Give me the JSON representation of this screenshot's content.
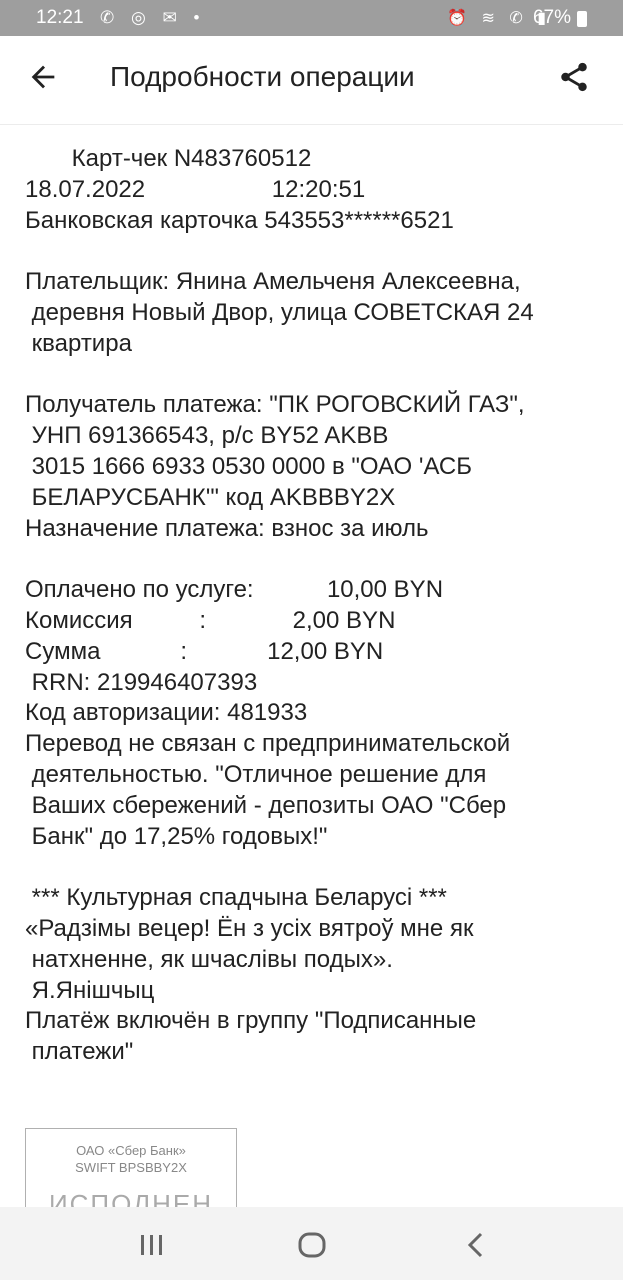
{
  "status_bar": {
    "time": "12:21",
    "left_icons": "✆ ◎ ✉ •",
    "right_icons": "⏰ ≋ ✆ ▮",
    "battery": "67%"
  },
  "header": {
    "title": "Подробности операции",
    "back_icon": "arrow-left-icon",
    "share_icon": "share-icon"
  },
  "receipt": {
    "lines": [
      "       Карт-чек N483760512",
      "18.07.2022                   12:20:51",
      "Банковская карточка 543553******6521",
      "",
      "Плательщик: Янина Амельченя Алексеевна,",
      " деревня Новый Двор, улица СОВЕТСКАЯ 24",
      " квартира",
      "",
      "Получатель платежа: \"ПК РОГОВСКИЙ ГАЗ\",",
      " УНП 691366543, р/с BY52 AKBB",
      " 3015 1666 6933 0530 0000 в \"ОАО 'АСБ",
      " БЕЛАРУСБАНК'\" код AKBBBY2X",
      "Назначение платежа: взнос за июль",
      "",
      "Оплачено по услуге:           10,00 BYN",
      "Комиссия          :             2,00 BYN",
      "Сумма            :            12,00 BYN",
      " RRN: 219946407393",
      "Код авторизации: 481933",
      "Перевод не связан с предпринимательской",
      " деятельностью. \"Отличное решение для",
      " Ваших сбережений - депозиты ОАО \"Сбер",
      " Банк\" до 17,25% годовых!\"",
      "",
      " *** Культурная спадчына Беларусі ***",
      "«Радзімы вецер! Ён з усіх вятроў мне як",
      " натхненне, як шчаслівы подых».",
      " Я.Янішчыц",
      "Платёж включён в группу \"Подписанные",
      " платежи\""
    ]
  },
  "stamp": {
    "bank": "ОАО «Сбер Банк»",
    "swift": "SWIFT BPSBBY2X",
    "status": "ИСПОЛНЕН"
  },
  "nav": {
    "recents_icon": "recents-icon",
    "home_icon": "home-icon",
    "back_icon": "nav-back-icon"
  }
}
